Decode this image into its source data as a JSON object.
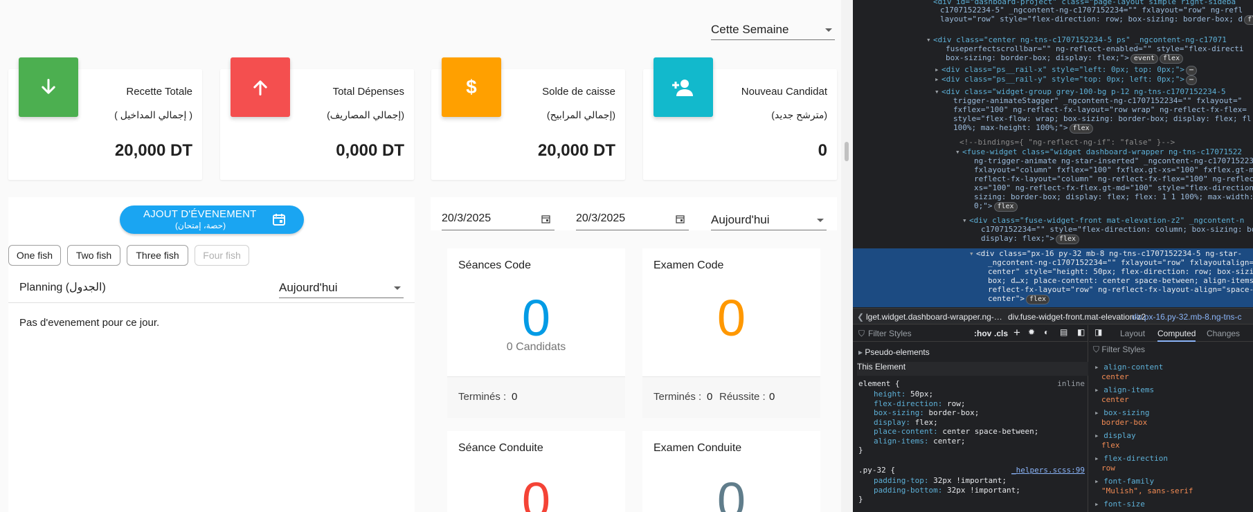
{
  "period_select": {
    "value": "Cette Semaine"
  },
  "stats": [
    {
      "label": "Recette Totale",
      "arabic": "( إجمالي المداخيل )",
      "value": "20,000 DT",
      "color": "#4caf50",
      "icon": "arrow-down-icon"
    },
    {
      "label": "Total Dépenses",
      "arabic": "(إجمالي المصاريف)",
      "value": "0,000 DT",
      "color": "#f44336",
      "icon": "arrow-up-icon"
    },
    {
      "label": "Solde de caisse",
      "arabic": "(إجمالي المرابيح)",
      "value": "20,000 DT",
      "color": "#ff9800",
      "icon": "dollar-icon"
    },
    {
      "label": "Nouveau Candidat",
      "arabic": "(مترشح جديد)",
      "value": "0",
      "color": "#00bcd4",
      "icon": "person-add-icon"
    }
  ],
  "planning": {
    "button_line1": "AJOUT D'ÉVENEMENT",
    "button_line2": "(حصة، إمتحان)",
    "chips": [
      "One fish",
      "Two fish",
      "Three fish",
      "Four fish"
    ],
    "title": "Planning (الجدول)",
    "period": "Aujourd'hui",
    "empty_message": "Pas d'evenement pour ce jour."
  },
  "filters": {
    "date_from": "20/3/2025",
    "date_to": "20/3/2025",
    "period": "Aujourd'hui"
  },
  "widgets": {
    "seances_code": {
      "title": "Séances Code",
      "value": "0",
      "sub": "0 Candidats",
      "termines_label": "Terminés :",
      "termines": "0",
      "color": "#039be5"
    },
    "examen_code": {
      "title": "Examen Code",
      "value": "0",
      "termines_label": "Terminés :",
      "termines": "0",
      "reussite_label": "Réussite :",
      "reussite": "0",
      "color": "#ff9800"
    },
    "seance_conduite": {
      "title": "Séance Conduite",
      "value": "0",
      "color": "#f44336"
    },
    "examen_conduite": {
      "title": "Examen Conduite",
      "value": "0",
      "color": "#607d8b"
    }
  },
  "devtools": {
    "dom_lines": [
      "<div id=\"dashboard-project\" class=\"page-layout simple right-sideba",
      "c1707152234-5\" _ngcontent-ng-c1707152234=\"\" fxlayout=\"row\" ng-refl",
      "layout=\"row\" style=\"flex-direction: row; box-sizing: border-box; d",
      "<div class=\"center ng-tns-c1707152234-5 ps\" _ngcontent-ng-c17071",
      "fuseperfectscrollbar=\"\" ng-reflect-enabled=\"\" style=\"flex-directi",
      "box-sizing: border-box; display: flex;\">",
      "<div class=\"ps__rail-x\" style=\"left: 0px; top: 0px;\">",
      "<div class=\"ps__rail-y\" style=\"top: 0px; left: 0px;\">",
      "<div class=\"widget-group grey-100-bg p-12 ng-tns-c1707152234-5",
      "trigger-animateStagger\" _ngcontent-ng-c1707152234=\"\" fxlayout=\"",
      "fxflex=\"100\" ng-reflect-fx-layout=\"row wrap\" ng-reflect-fx-flex=",
      "style=\"flex-flow: wrap; box-sizing: border-box; display: flex; fl",
      "100%; max-height: 100%;\">",
      "<!--bindings={ \"ng-reflect-ng-if\": \"false\" }-->",
      "<fuse-widget class=\"widget dashboard-wrapper ng-tns-c17071522",
      "ng-trigger-animate ng-star-inserted\" _ngcontent-ng-c1707152234",
      "fxlayout=\"column\" fxflex=\"100\" fxflex.gt-xs=\"100\" fxflex.gt-m",
      "reflect-fx-layout=\"column\" ng-reflect-fx-flex=\"100\" ng-reflec",
      "xs=\"100\" ng-reflect-fx-flex.gt-md=\"100\" style=\"flex-direction",
      "sizing: border-box; display: flex; flex: 1 1 100%; max-width:",
      "0;\">",
      "<div class=\"fuse-widget-front mat-elevation-z2\" _ngcontent-n",
      "c1707152234=\"\" style=\"flex-direction: column; box-sizing: bo",
      "display: flex;\">",
      "<div class=\"px-16 py-32 mb-8 ng-tns-c1707152234-5 ng-star-",
      "_ngcontent-ng-c1707152234=\"\" fxlayout=\"row\" fxlayoutalign=",
      "center\" style=\"height: 50px; flex-direction: row; box-sizi",
      "box; d…x; place-content: center space-between; align-items",
      "reflect-fx-layout=\"row\" ng-reflect-fx-layout-align=\"space-",
      "center\">"
    ],
    "badges": {
      "flex": "flex",
      "event": "event"
    },
    "breadcrumbs": [
      "lget.widget.dashboard-wrapper.ng-…",
      "div.fuse-widget-front.mat-elevation-z2",
      "div.px-16.py-32.mb-8.ng-tns-c"
    ],
    "styles_filter": "Filter Styles",
    "hov": ":hov",
    "cls": ".cls",
    "tabs": [
      "Layout",
      "Computed",
      "Changes"
    ],
    "pseudo": "Pseudo-elements",
    "this_element": "This Element",
    "element_rule": {
      "selector": "element {",
      "origin": "inline",
      "props": [
        {
          "name": "height",
          "value": "50px;"
        },
        {
          "name": "flex-direction",
          "value": "row;"
        },
        {
          "name": "box-sizing",
          "value": "border-box;"
        },
        {
          "name": "display",
          "value": "flex;"
        },
        {
          "name": "place-content",
          "value": "center space-between;"
        },
        {
          "name": "align-items",
          "value": "center;"
        }
      ]
    },
    "py_rule": {
      "selector": ".py-32 {",
      "origin": "_helpers.scss:99",
      "props": [
        {
          "name": "padding-top",
          "value": "32px !important;"
        },
        {
          "name": "padding-bottom",
          "value": "32px !important;"
        }
      ]
    },
    "computed_filter": "Filter Styles",
    "computed": [
      {
        "name": "align-content",
        "value": "center"
      },
      {
        "name": "align-items",
        "value": "center"
      },
      {
        "name": "box-sizing",
        "value": "border-box"
      },
      {
        "name": "display",
        "value": "flex"
      },
      {
        "name": "flex-direction",
        "value": "row"
      },
      {
        "name": "font-family",
        "value": "\"Mulish\", sans-serif"
      },
      {
        "name": "font-size",
        "value": ""
      }
    ]
  }
}
